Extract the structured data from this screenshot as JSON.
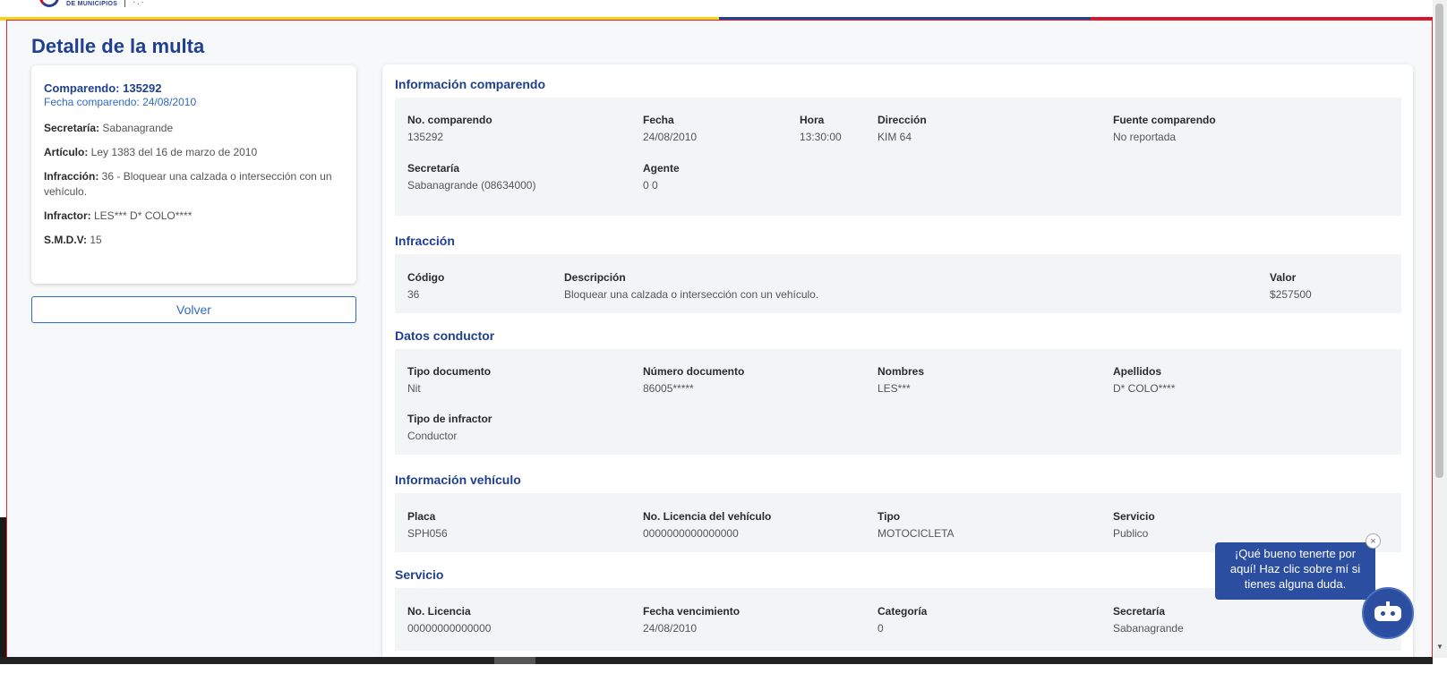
{
  "header": {
    "logo_text": "DE MUNICIPIOS"
  },
  "page": {
    "title": "Detalle de la multa"
  },
  "summary": {
    "comparendo": "Comparendo: 135292",
    "fecha": "Fecha comparendo: 24/08/2010",
    "secretaria_label": "Secretaría:",
    "secretaria_value": " Sabanagrande",
    "articulo_label": "Artículo:",
    "articulo_value": " Ley 1383 del 16 de marzo de 2010",
    "infraccion_label": "Infracción:",
    "infraccion_value": " 36 - Bloquear una calzada o intersección con un vehículo.",
    "infractor_label": "Infractor:",
    "infractor_value": " LES*** D* COLO****",
    "smdv_label": "S.M.D.V:",
    "smdv_value": " 15",
    "back_button": "Volver"
  },
  "sections": {
    "comparendo": {
      "title": "Información comparendo",
      "no_label": "No. comparendo",
      "no_value": "135292",
      "fecha_label": "Fecha",
      "fecha_value": "24/08/2010",
      "hora_label": "Hora",
      "hora_value": "13:30:00",
      "direccion_label": "Dirección",
      "direccion_value": "KIM 64",
      "fuente_label": "Fuente comparendo",
      "fuente_value": "No reportada",
      "secretaria_label": "Secretaría",
      "secretaria_value": "Sabanagrande (08634000)",
      "agente_label": "Agente",
      "agente_value": "0 0"
    },
    "infraccion": {
      "title": "Infracción",
      "codigo_label": "Código",
      "codigo_value": "36",
      "descripcion_label": "Descripción",
      "descripcion_value": "Bloquear una calzada o intersección con un vehículo.",
      "valor_label": "Valor",
      "valor_value": "$257500"
    },
    "conductor": {
      "title": "Datos conductor",
      "tipo_doc_label": "Tipo documento",
      "tipo_doc_value": "Nit",
      "num_doc_label": "Número documento",
      "num_doc_value": "86005*****",
      "nombres_label": "Nombres",
      "nombres_value": "LES***",
      "apellidos_label": "Apellidos",
      "apellidos_value": "D* COLO****",
      "tipo_inf_label": "Tipo de infractor",
      "tipo_inf_value": "Conductor"
    },
    "vehiculo": {
      "title": "Información vehículo",
      "placa_label": "Placa",
      "placa_value": "SPH056",
      "licencia_label": "No. Licencia del vehículo",
      "licencia_value": "0000000000000000",
      "tipo_label": "Tipo",
      "tipo_value": "MOTOCICLETA",
      "servicio_label": "Servicio",
      "servicio_value": "Publico"
    },
    "servicio": {
      "title": "Servicio",
      "licencia_label": "No. Licencia",
      "licencia_value": "00000000000000",
      "vencimiento_label": "Fecha vencimiento",
      "vencimiento_value": "24/08/2010",
      "categoria_label": "Categoría",
      "categoria_value": "0",
      "secretaria_label": "Secretaría",
      "secretaria_value": "Sabanagrande"
    }
  },
  "chat": {
    "message": "¡Qué bueno tenerte por aquí! Haz clic sobre mí si tienes alguna duda.",
    "close_glyph": "×"
  },
  "colors": {
    "primary": "#1f3f8f",
    "link": "#2f6bbf",
    "flag_yellow": "#f7d21a",
    "flag_blue": "#2a3f91",
    "flag_red": "#d5152d",
    "frame_border": "#e3262e"
  }
}
